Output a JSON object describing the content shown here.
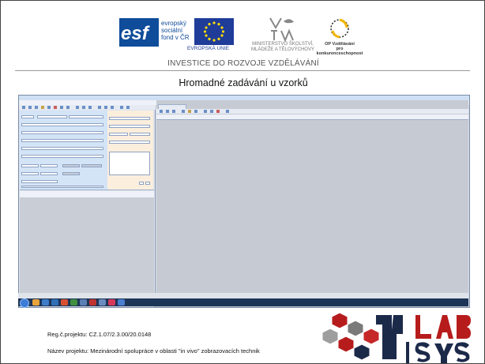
{
  "logos": {
    "esf_word": "esf",
    "esf_lines": [
      "evropský",
      "sociální",
      "fond v ČR"
    ],
    "eu_caption": "EVROPSKÁ UNIE",
    "msmt_caption": [
      "MINISTERSTVO ŠKOLSTVÍ,",
      "MLÁDEŽE A TĚLOVÝCHOVY"
    ],
    "op_caption": [
      "OP Vzdělávání",
      "pro konkurenceschopnost"
    ],
    "invest_tagline": "INVESTICE DO ROZVOJE VZDĚLÁVÁNÍ"
  },
  "slide_title": "Hromadné zadávání u vzorků",
  "footer": {
    "reg": "Reg.č.projektu: CZ.1.07/2.3.00/20.0148",
    "nazev": "Název projektu: Mezinárodní spolupráce v oblasti \"in vivo\" zobrazovacích technik"
  },
  "colors": {
    "esf_blue": "#0f4c9a",
    "eu_blue": "#1f3c99",
    "lab_red": "#b71c1c",
    "lab_navy": "#1c2a4a",
    "taskbar": "#1d3557"
  },
  "icons": [
    "esf-logo",
    "eu-flag-icon",
    "msmt-logo",
    "op-logo",
    "lab-logo",
    "start-orb-icon"
  ]
}
